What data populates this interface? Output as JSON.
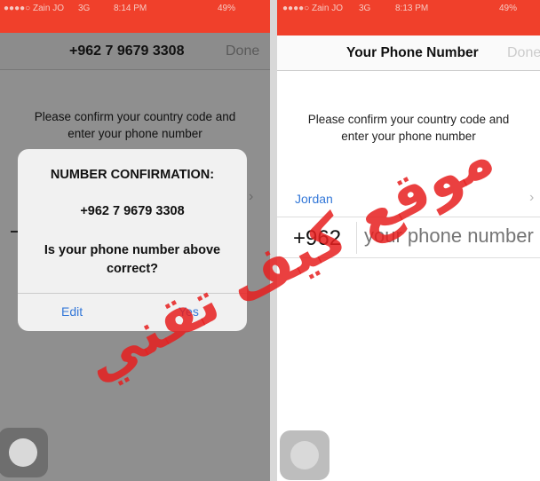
{
  "left_screen": {
    "status": {
      "carrier": "●●●●○ Zain JO",
      "network": "3G",
      "time": "8:14 PM",
      "battery": "49%"
    },
    "nav": {
      "title": "+962 7 9679 3308",
      "done": "Done"
    },
    "prompt": [
      "Please confirm your country code and",
      "enter your phone number"
    ],
    "alert": {
      "title": "NUMBER CONFIRMATION:",
      "number": "+962 7 9679 3308",
      "question": "Is your phone number above correct?",
      "edit": "Edit",
      "yes": "Yes"
    }
  },
  "right_screen": {
    "status": {
      "carrier": "●●●●○ Zain JO",
      "network": "3G",
      "time": "8:13 PM",
      "battery": "49%"
    },
    "nav": {
      "title": "Your Phone Number",
      "done": "Done"
    },
    "prompt": [
      "Please confirm your country code and",
      "enter your phone number"
    ],
    "country": "Jordan",
    "code": "+962",
    "phone_placeholder": "your phone number"
  },
  "watermark": "موقع كيف تقني",
  "colors": {
    "status_red": "#f0402b",
    "link_blue": "#3478d8"
  }
}
